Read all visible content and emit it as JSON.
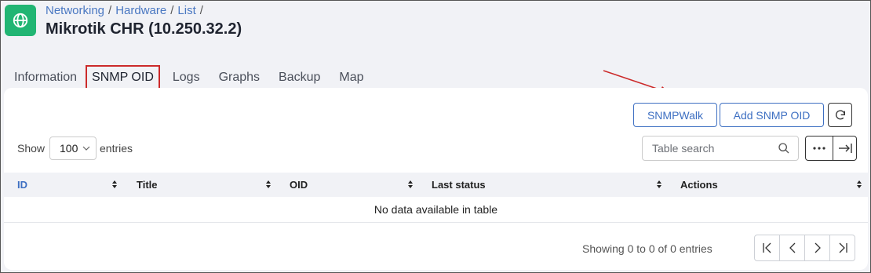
{
  "header": {
    "breadcrumb": [
      "Networking",
      "Hardware",
      "List"
    ],
    "separator": "/",
    "title": "Mikrotik CHR (10.250.32.2)",
    "app_icon": "globe-icon",
    "accent_color": "#21b573"
  },
  "tabs": [
    {
      "label": "Information",
      "active": false
    },
    {
      "label": "SNMP OID",
      "active": true
    },
    {
      "label": "Logs",
      "active": false
    },
    {
      "label": "Graphs",
      "active": false
    },
    {
      "label": "Backup",
      "active": false
    },
    {
      "label": "Map",
      "active": false
    }
  ],
  "toolbar": {
    "snmpwalk_label": "SNMPWalk",
    "add_label": "Add SNMP OID",
    "refresh_icon": "refresh-icon"
  },
  "table_controls": {
    "show_label": "Show",
    "entries_label": "entries",
    "page_size": "100",
    "search_placeholder": "Table search"
  },
  "table": {
    "columns": [
      "ID",
      "Title",
      "OID",
      "Last status",
      "Actions"
    ],
    "empty_message": "No data available in table"
  },
  "footer": {
    "showing_text": "Showing 0 to 0 of 0 entries"
  },
  "colors": {
    "link": "#4a78c2",
    "primary": "#3d6fc2",
    "highlight_border": "#cc2a2a",
    "annotation_arrow": "#cc2a2a"
  }
}
